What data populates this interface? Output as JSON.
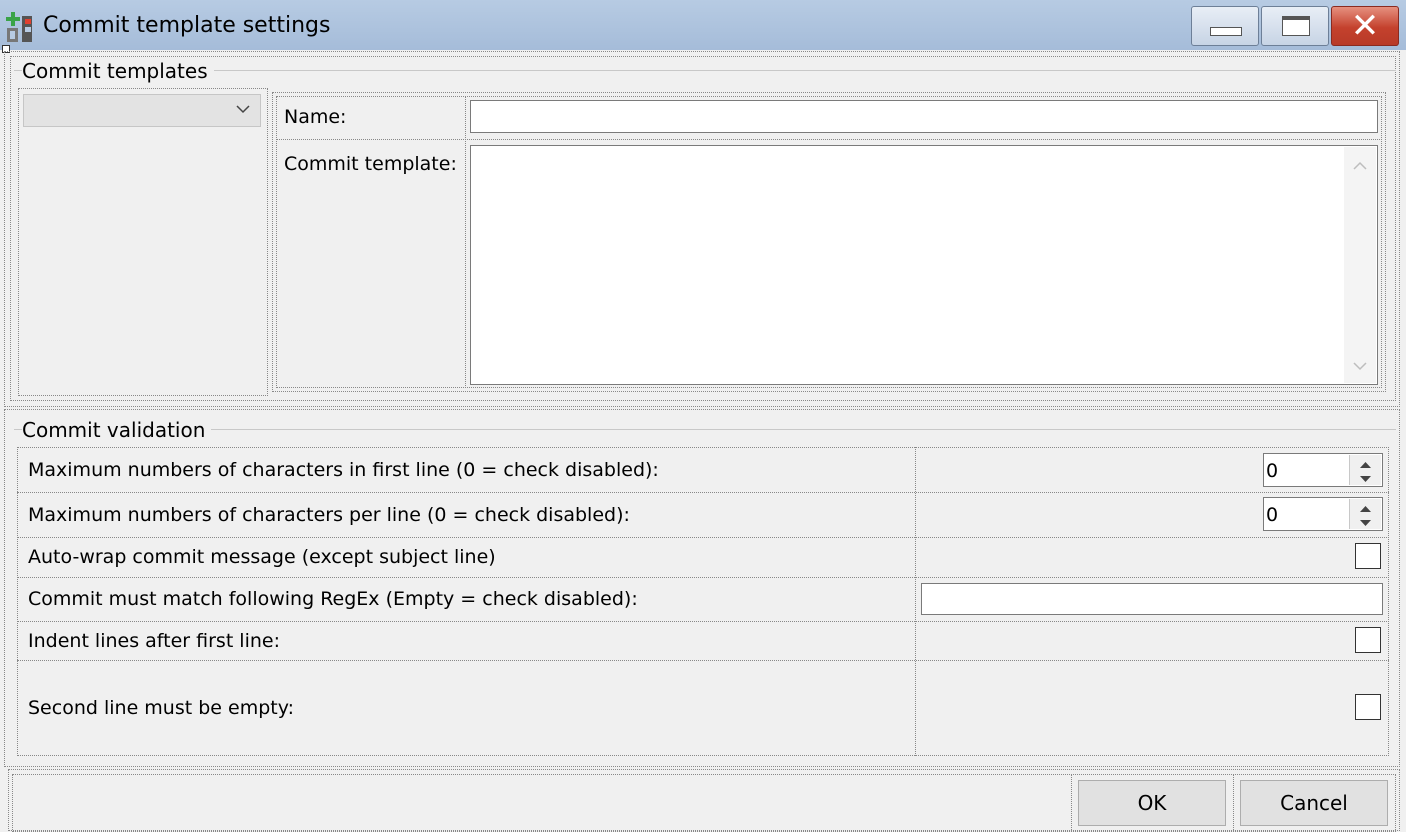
{
  "window": {
    "title": "Commit template settings",
    "icon_name": "gitextensions-app-icon",
    "controls": [
      "minimize-button",
      "maximize-button",
      "close-button"
    ],
    "close_glyph": "✕"
  },
  "templates": {
    "group_label": "Commit templates",
    "select_value": "",
    "name_label": "Name:",
    "name_value": "",
    "template_label": "Commit template:",
    "template_value": ""
  },
  "validation": {
    "group_label": "Commit validation",
    "rows": {
      "max_first_line_label": "Maximum numbers of characters in first line (0 = check disabled):",
      "max_first_line_value": "0",
      "max_per_line_label": "Maximum numbers of characters per line (0 = check disabled):",
      "max_per_line_value": "0",
      "auto_wrap_label": "Auto-wrap commit message (except subject line)",
      "auto_wrap_checked": false,
      "regex_label": "Commit must match following RegEx (Empty = check disabled):",
      "regex_value": "",
      "indent_label": "Indent lines after first line:",
      "indent_checked": false,
      "second_line_label": "Second line must be empty:",
      "second_line_checked": false
    }
  },
  "buttons": {
    "ok": "OK",
    "cancel": "Cancel"
  },
  "colors": {
    "titlebar": "#a5bcd9",
    "close_button": "#c4412d",
    "dialog_bg": "#f0f0f0"
  }
}
